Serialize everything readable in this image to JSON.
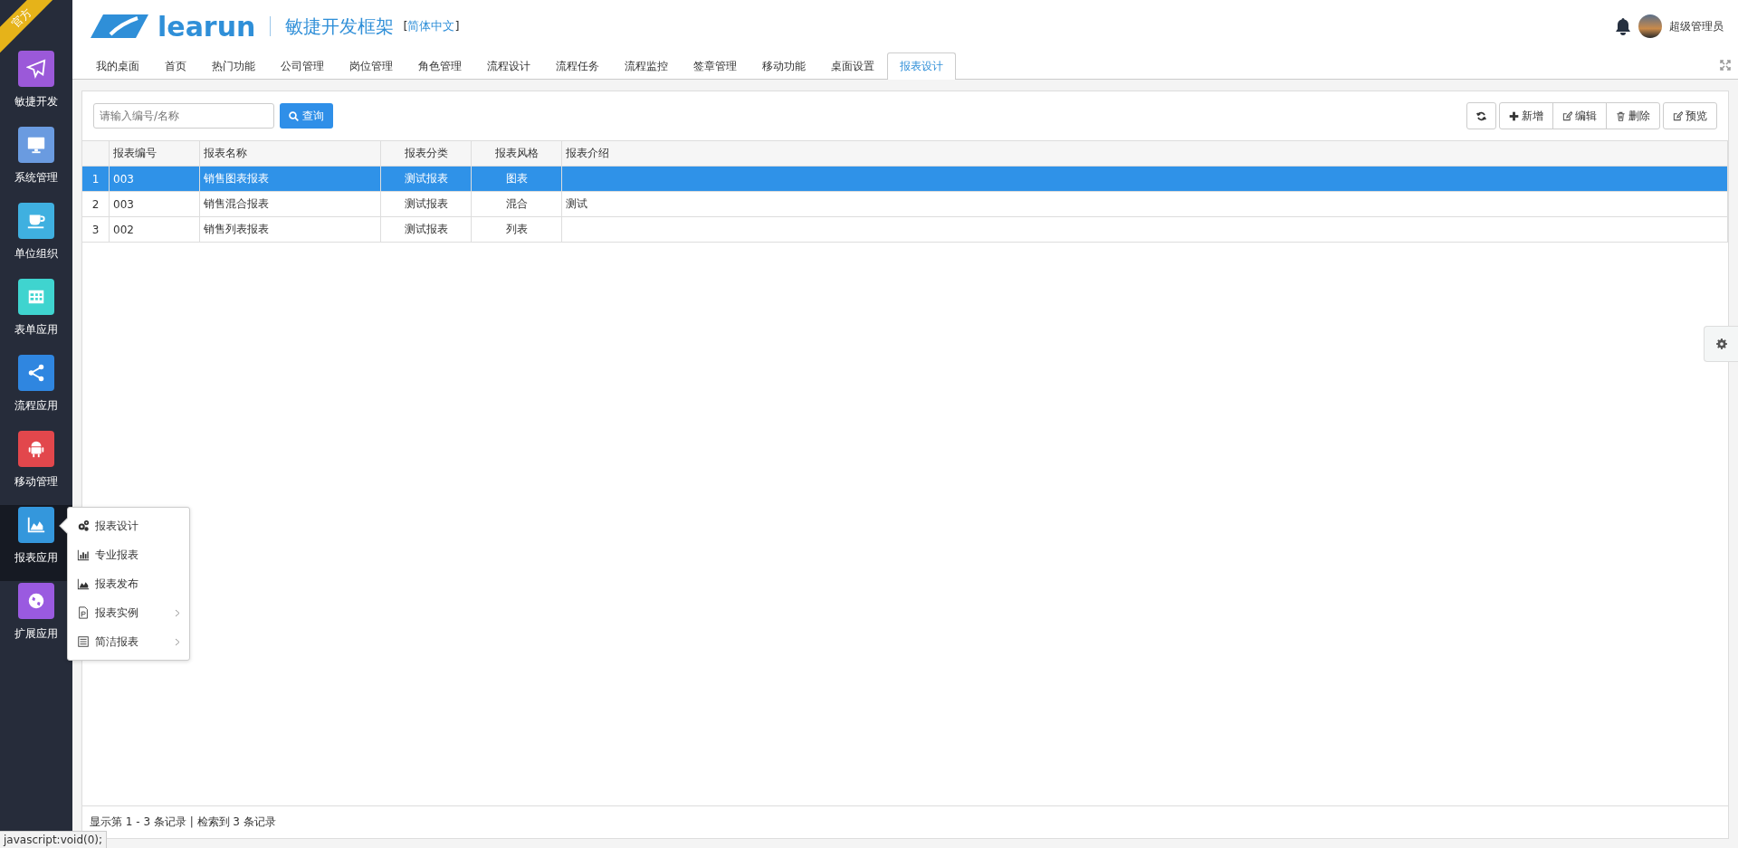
{
  "ribbon": "官方",
  "brand": {
    "logo_text": "learun",
    "title": "敏捷开发框架",
    "lang_open": "[",
    "lang": "简体中文",
    "lang_close": "]"
  },
  "user": {
    "name": "超级管理员"
  },
  "sidebar": {
    "items": [
      {
        "label": "敏捷开发",
        "color": "#9b59d9",
        "selected": false
      },
      {
        "label": "系统管理",
        "color": "#6a9be0",
        "selected": false
      },
      {
        "label": "单位组织",
        "color": "#3fb0e0",
        "selected": false
      },
      {
        "label": "表单应用",
        "color": "#3fd4cf",
        "selected": false
      },
      {
        "label": "流程应用",
        "color": "#2f86e0",
        "selected": false
      },
      {
        "label": "移动管理",
        "color": "#e2474c",
        "selected": false
      },
      {
        "label": "报表应用",
        "color": "#3497dc",
        "selected": true
      },
      {
        "label": "扩展应用",
        "color": "#9a5ae0",
        "selected": false
      }
    ]
  },
  "submenu": {
    "items": [
      {
        "label": "报表设计",
        "has_children": false
      },
      {
        "label": "专业报表",
        "has_children": false
      },
      {
        "label": "报表发布",
        "has_children": false
      },
      {
        "label": "报表实例",
        "has_children": true
      },
      {
        "label": "简洁报表",
        "has_children": true
      }
    ]
  },
  "tabs": [
    {
      "label": "我的桌面",
      "selected": false
    },
    {
      "label": "首页",
      "selected": false
    },
    {
      "label": "热门功能",
      "selected": false
    },
    {
      "label": "公司管理",
      "selected": false
    },
    {
      "label": "岗位管理",
      "selected": false
    },
    {
      "label": "角色管理",
      "selected": false
    },
    {
      "label": "流程设计",
      "selected": false
    },
    {
      "label": "流程任务",
      "selected": false
    },
    {
      "label": "流程监控",
      "selected": false
    },
    {
      "label": "签章管理",
      "selected": false
    },
    {
      "label": "移动功能",
      "selected": false
    },
    {
      "label": "桌面设置",
      "selected": false
    },
    {
      "label": "报表设计",
      "selected": true
    }
  ],
  "search": {
    "placeholder": "请输入编号/名称",
    "button": "查询"
  },
  "toolbar": [
    {
      "kind": "refresh"
    },
    {
      "kind": "add",
      "label": "新增"
    },
    {
      "kind": "edit",
      "label": "编辑"
    },
    {
      "kind": "delete",
      "label": "删除"
    },
    {
      "kind": "preview",
      "label": "预览"
    }
  ],
  "table": {
    "columns": [
      "报表编号",
      "报表名称",
      "报表分类",
      "报表风格",
      "报表介绍"
    ],
    "rows": [
      {
        "index": "1",
        "cells": [
          "003",
          "销售图表报表",
          "测试报表",
          "图表",
          ""
        ],
        "selected": true
      },
      {
        "index": "2",
        "cells": [
          "003",
          "销售混合报表",
          "测试报表",
          "混合",
          "测试"
        ],
        "selected": false
      },
      {
        "index": "3",
        "cells": [
          "002",
          "销售列表报表",
          "测试报表",
          "列表",
          ""
        ],
        "selected": false
      }
    ]
  },
  "footer": "显示第 1 - 3 条记录 | 检索到 3 条记录",
  "status_bar": "javascript:void(0);"
}
